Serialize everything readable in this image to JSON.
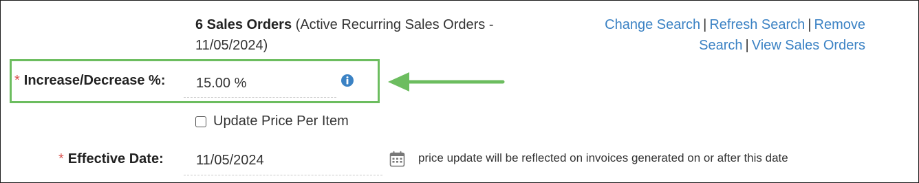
{
  "summary": {
    "count": "6 Sales Orders",
    "detail": "(Active Recurring Sales Orders - 11/05/2024)"
  },
  "links": {
    "change_search": "Change Search",
    "refresh_search": "Refresh Search",
    "remove_search": "Remove Search",
    "view_sales_orders": "View Sales Orders",
    "separator": "|"
  },
  "form": {
    "required_marker": "*",
    "increase_decrease": {
      "label": "Increase/Decrease %:",
      "value": "15.00 %"
    },
    "update_price_per_item": {
      "label": "Update Price Per Item",
      "checked": false
    },
    "effective_date": {
      "label": "Effective Date:",
      "value": "11/05/2024",
      "note": "price update will be reflected on invoices generated on or after this date"
    }
  },
  "colors": {
    "link": "#3b82c4",
    "required": "#d9534f",
    "highlight": "#6cbd5f",
    "info_icon": "#3b82c4"
  },
  "icons": {
    "info": "info-icon",
    "calendar": "calendar-icon",
    "arrow": "arrow-left-icon"
  }
}
